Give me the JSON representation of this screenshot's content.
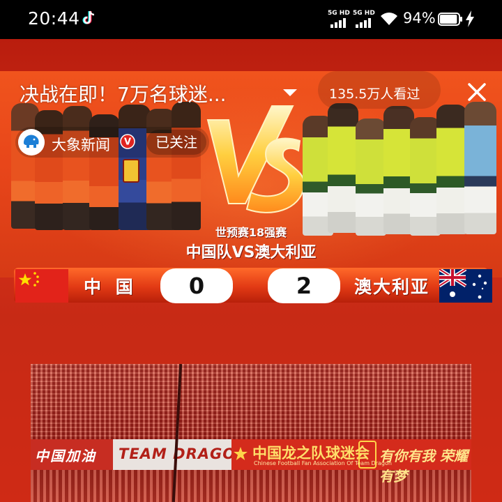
{
  "status_bar": {
    "time": "20:44",
    "sim1_label": "5G HD",
    "sim2_label": "5G HD",
    "battery_percent": "94%",
    "battery_level": 0.94,
    "icons": [
      "tiktok-icon",
      "signal-icon",
      "wifi-icon",
      "battery-icon",
      "charging-icon"
    ]
  },
  "video": {
    "title": "决战在即！7万名球迷...",
    "views": "135.5万人看过",
    "channel": {
      "name": "大象新闻",
      "avatar_text": "大象新闻",
      "verified_mark": "V",
      "follow_label": "已关注"
    }
  },
  "match_banner": {
    "qualifier": "世预赛18强赛",
    "title": "中国队VS澳大利亚",
    "home_team": "中 国",
    "away_team": "澳大利亚",
    "home_score": "0",
    "away_score": "2"
  },
  "crowd_banner": {
    "left_text": "中国加油",
    "team_text": "TEAM DRAGON",
    "fan_text": "中国龙之队球迷会",
    "fan_subtext": "Chinese Football Fan Association Of Team Dragon",
    "right_text": "有你有我 荣耀有梦"
  },
  "colors": {
    "status_bar": "#000000",
    "background_red": "#c92512",
    "banner_orange": "#e8461a",
    "score_box": "#ffffff"
  }
}
